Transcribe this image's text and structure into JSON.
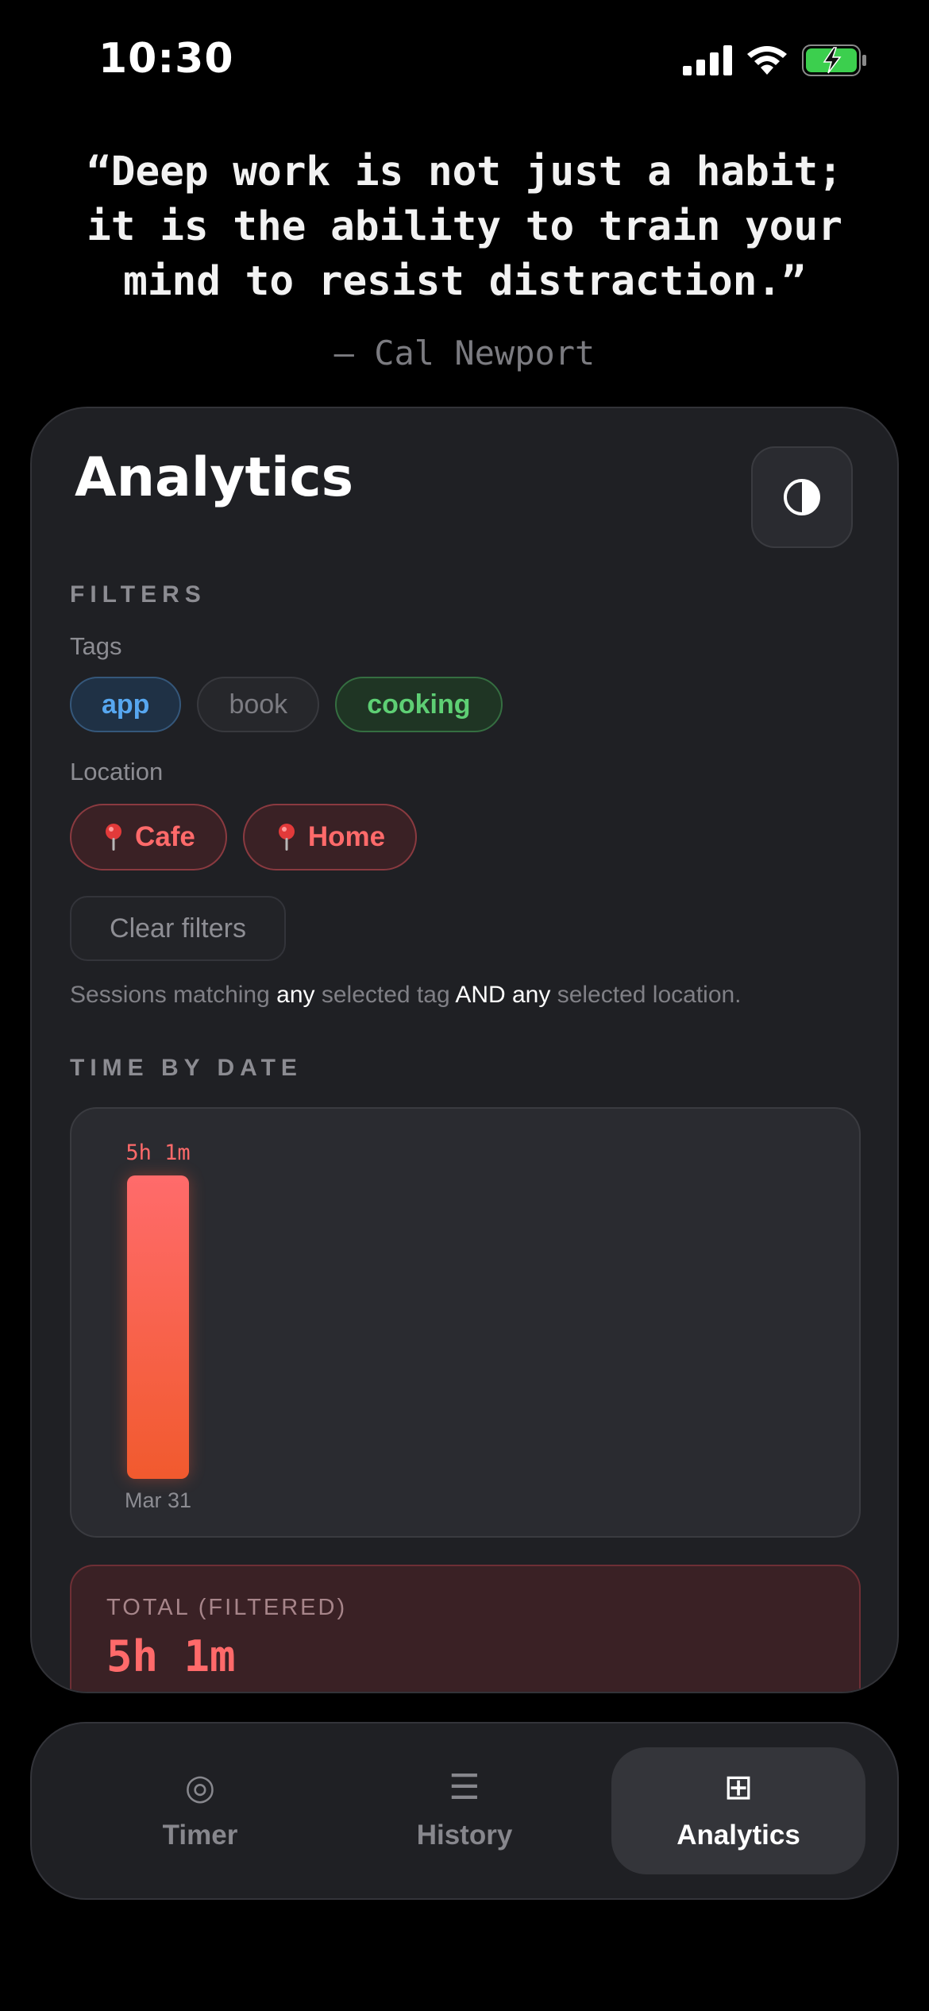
{
  "status": {
    "time": "10:30"
  },
  "quote": {
    "line1": "“Deep work is not just a habit;",
    "line2": "it is the ability to train your",
    "line3": "mind to resist distraction.”",
    "author": "— Cal Newport"
  },
  "analytics": {
    "title": "Analytics",
    "theme_icon": "half-circle-contrast-icon",
    "filters_label": "FILTERS",
    "tags_label": "Tags",
    "tags": [
      {
        "label": "app",
        "selected": true,
        "color": "#57a7f0"
      },
      {
        "label": "book",
        "selected": false,
        "color": "#7c7c82"
      },
      {
        "label": "cooking",
        "selected": true,
        "color": "#5ecf74"
      }
    ],
    "location_label": "Location",
    "locations": [
      {
        "label": "Cafe",
        "icon": "pin-icon"
      },
      {
        "label": "Home",
        "icon": "pin-icon"
      }
    ],
    "clear_label": "Clear filters",
    "hint": {
      "p1": "Sessions matching ",
      "any1": "any",
      "p2": " selected tag ",
      "and": "AND",
      "p3": " ",
      "any2": "any",
      "p4": " selected location."
    },
    "time_by_date_label": "TIME BY DATE",
    "total_label": "TOTAL (FILTERED)",
    "total_value": "5h 1m"
  },
  "chart_data": {
    "type": "bar",
    "categories": [
      "Mar 31"
    ],
    "values": [
      301
    ],
    "value_labels": [
      "5h 1m"
    ],
    "ylim": [
      0,
      301
    ],
    "bar_color": "#ff6b63"
  },
  "nav": {
    "items": [
      {
        "label": "Timer",
        "icon": "◎"
      },
      {
        "label": "History",
        "icon": "☰"
      },
      {
        "label": "Analytics",
        "icon": "⊞"
      }
    ],
    "active": "Analytics"
  },
  "colors": {
    "accent_red": "#ff6a6a",
    "card_bg": "#1f2024"
  }
}
